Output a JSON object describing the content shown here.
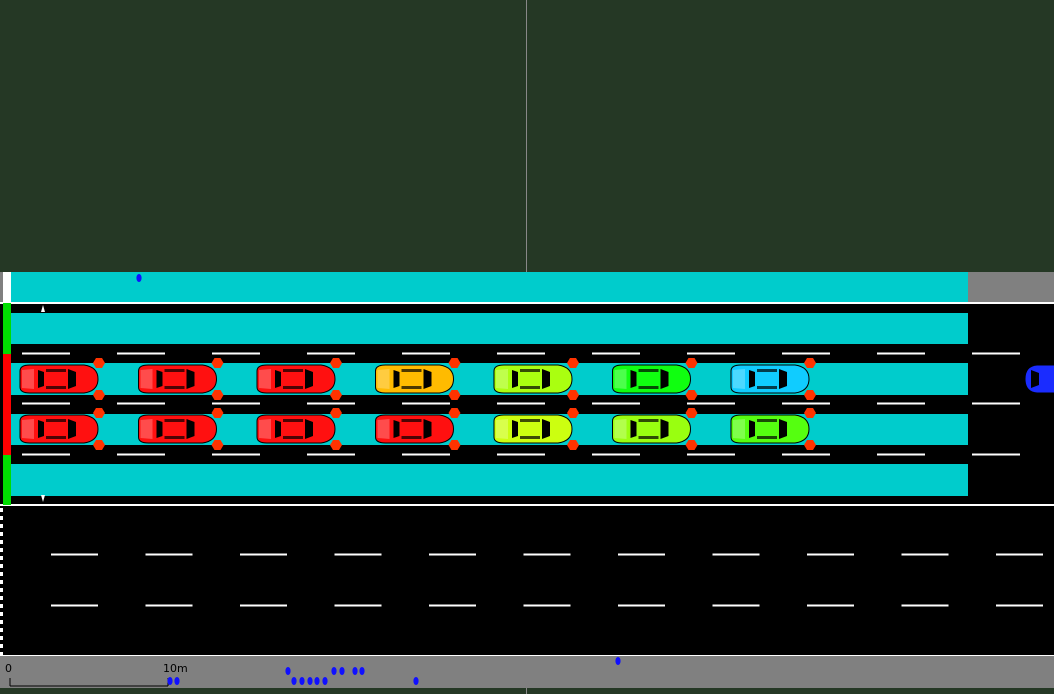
{
  "scale_bar": {
    "start_label": "0",
    "end_label": "10m"
  },
  "colors": {
    "background": "#253825",
    "road": "#000000",
    "lane_highlight": "#00cccc",
    "sidewalk": "#808080",
    "lane_marking": "#ffffff",
    "signal_red": "#ff0000",
    "signal_green": "#00dd00",
    "pedestrian": "#1010ff"
  },
  "traffic_light_states": [
    "white",
    "green",
    "red",
    "red",
    "green"
  ],
  "vehicles": {
    "upper_row": [
      {
        "color": "#ff1010",
        "role": "car"
      },
      {
        "color": "#ff1010",
        "role": "car"
      },
      {
        "color": "#ff1010",
        "role": "car"
      },
      {
        "color": "#ffbb00",
        "role": "car"
      },
      {
        "color": "#aaff10",
        "role": "car"
      },
      {
        "color": "#10ff10",
        "role": "car"
      },
      {
        "color": "#10ccff",
        "role": "car"
      }
    ],
    "lower_row": [
      {
        "color": "#ff1010",
        "role": "car"
      },
      {
        "color": "#ff1010",
        "role": "car"
      },
      {
        "color": "#ff1010",
        "role": "car"
      },
      {
        "color": "#ff1010",
        "role": "car"
      },
      {
        "color": "#ccff10",
        "role": "car"
      },
      {
        "color": "#99ff10",
        "role": "car"
      },
      {
        "color": "#55ff10",
        "role": "car"
      }
    ],
    "incoming": {
      "color": "#1a2cff",
      "role": "car"
    }
  }
}
